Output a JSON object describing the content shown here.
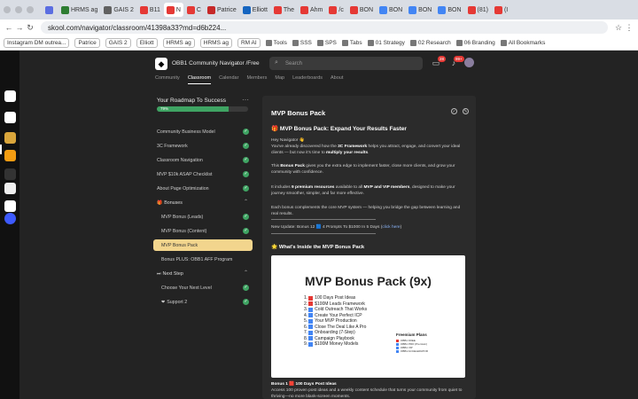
{
  "browser": {
    "tabs": [
      {
        "label": "",
        "color": "#5b6ee1"
      },
      {
        "label": "HRMS ag",
        "color": "#2e7d32"
      },
      {
        "label": "GAIS 2",
        "color": "#616161"
      },
      {
        "label": "B11",
        "color": "#e53935"
      },
      {
        "label": "N",
        "color": "#e53935",
        "active": true
      },
      {
        "label": "C",
        "color": "#e53935"
      },
      {
        "label": "Patrice",
        "color": "#c62828"
      },
      {
        "label": "Elliott",
        "color": "#1565c0"
      },
      {
        "label": "The",
        "color": "#e53935"
      },
      {
        "label": "Ahm",
        "color": "#e53935"
      },
      {
        "label": "/c",
        "color": "#e53935"
      },
      {
        "label": "BON",
        "color": "#e53935"
      },
      {
        "label": "BON",
        "color": "#4285f4"
      },
      {
        "label": "BON",
        "color": "#4285f4"
      },
      {
        "label": "BON",
        "color": "#4285f4"
      },
      {
        "label": "(81)",
        "color": "#e53935"
      },
      {
        "label": "(I",
        "color": "#e53935"
      }
    ],
    "url": "skool.com/navigator/classroom/41398a33?md=d6b224...",
    "bookmarks": [
      {
        "label": "Instagram DM outrea...",
        "pill": true
      },
      {
        "label": "Patrice",
        "pill": true
      },
      {
        "label": "GAIS 2",
        "pill": true
      },
      {
        "label": "Elliott",
        "pill": true
      },
      {
        "label": "HRMS ag",
        "pill": true
      },
      {
        "label": "HRMS ag",
        "pill": true
      },
      {
        "label": "RM AI",
        "pill": true
      },
      {
        "label": "Tools",
        "pill": false
      },
      {
        "label": "SSS",
        "pill": false
      },
      {
        "label": "SPS",
        "pill": false
      },
      {
        "label": "Tabs",
        "pill": false
      },
      {
        "label": "01 Strategy",
        "pill": false
      },
      {
        "label": "02 Research",
        "pill": false
      },
      {
        "label": "06 Branding",
        "pill": false
      },
      {
        "label": "All Bookmarks",
        "pill": false
      }
    ]
  },
  "header": {
    "community_name": "OBB1 Community Navigator /Free",
    "search_placeholder": "Search",
    "chat_badge": "28",
    "notif_badge": "99+"
  },
  "nav": [
    "Community",
    "Classroom",
    "Calendar",
    "Members",
    "Map",
    "Leaderboards",
    "About"
  ],
  "sidebar": {
    "title": "Your Roadmap To Success",
    "progress": 79,
    "progress_label": "79%",
    "items": [
      {
        "label": "Community Business Model",
        "type": "lesson",
        "done": true
      },
      {
        "label": "3C Framework",
        "type": "lesson",
        "done": true
      },
      {
        "label": "Classroom Navigation",
        "type": "lesson",
        "done": true
      },
      {
        "label": "MVP $10k ASAP Checklist",
        "type": "lesson",
        "done": true
      },
      {
        "label": "About Page Optimization",
        "type": "lesson",
        "done": true
      },
      {
        "label": "Bonuses",
        "type": "section",
        "emoji": "🎁"
      },
      {
        "label": "MVP Bonus (Leads)",
        "type": "sub",
        "done": true
      },
      {
        "label": "MVP Bonus (Content)",
        "type": "sub",
        "done": true
      },
      {
        "label": "MVP Bonus Pack",
        "type": "sub",
        "done": false,
        "active": true
      },
      {
        "label": "Bonus PLUS: OBB1 AFF Program",
        "type": "sub",
        "done": false
      },
      {
        "label": "Next Step",
        "type": "section",
        "emoji": "⏭"
      },
      {
        "label": "Choose Your Next Level",
        "type": "sub",
        "done": true
      },
      {
        "label": "Support 2",
        "type": "sub",
        "done": true,
        "emoji": "❤"
      }
    ]
  },
  "content": {
    "title": "MVP Bonus Pack",
    "heading": "MVP Bonus Pack: Expand Your Results Faster",
    "greeting": "Hey Navigator 👋",
    "p1_a": "You've already discovered how the ",
    "p1_b": "3C Framework",
    "p1_c": " helps you attract, engage, and convert your ideal clients — but now it's time to ",
    "p1_d": "multiply your results",
    "p1_e": ".",
    "p2_a": "This ",
    "p2_b": "Bonus Pack",
    "p2_c": " gives you the extra edge to implement faster, close more clients, and grow your community with confidence.",
    "p3_a": "It includes ",
    "p3_b": "9 premium resources",
    "p3_c": " available to all ",
    "p3_d": "MVP and VIP members",
    "p3_e": ", designed to make your journey smoother, simpler, and far more effective.",
    "p4": "Each bonus complements the core MVP system — helping you bridge the gap between learning and real results.",
    "update_a": "New Update: Bonus 12 🟦 4 Prompts To $1000 In 5 Days (",
    "update_link": "click here",
    "update_b": ")",
    "inside_heading": "What's Inside the MVP Bonus Pack",
    "promo_title": "MVP Bonus Pack (9x)",
    "promo_items": [
      {
        "num": "1.",
        "label": "100 Days Post Ideas",
        "color": "#e53935"
      },
      {
        "num": "2.",
        "label": "$100M Leads Framework",
        "color": "#e53935"
      },
      {
        "num": "3.",
        "label": "Cold Outreach That Works",
        "color": "#4285f4"
      },
      {
        "num": "4.",
        "label": "Create Your Perfect ICP",
        "color": "#4285f4"
      },
      {
        "num": "5.",
        "label": "Your MVP Production",
        "color": "#4285f4"
      },
      {
        "num": "6.",
        "label": "Close The Deal Like A Pro",
        "color": "#4285f4"
      },
      {
        "num": "7.",
        "label": "Onboarding (7-Step)",
        "color": "#4285f4"
      },
      {
        "num": "8.",
        "label": "Campaign Playbook",
        "color": "#4285f4"
      },
      {
        "num": "9.",
        "label": "$100M Money Models",
        "color": "#4285f4"
      }
    ],
    "plans_title": "Freemium Plans",
    "plans": [
      {
        "label": "OBB1 FREE",
        "color": "#e53935"
      },
      {
        "label": "OBB1 PRO (Premium)",
        "color": "#4285f4"
      },
      {
        "label": "OBB1 VIP",
        "color": "#4285f4"
      },
      {
        "label": "OBB1 ACCELERATOR",
        "color": "#4285f4"
      }
    ],
    "bonus1_a": "Bonus 1 🟥 100 Days Post Ideas",
    "bonus1_b": "Access 100 proven post ideas and a weekly content schedule that turns your community from quiet to thriving—no more blank-screen moments."
  },
  "colors": {
    "accent_active": "#f2d58d",
    "check": "#3fa463",
    "badge": "#e53935"
  }
}
